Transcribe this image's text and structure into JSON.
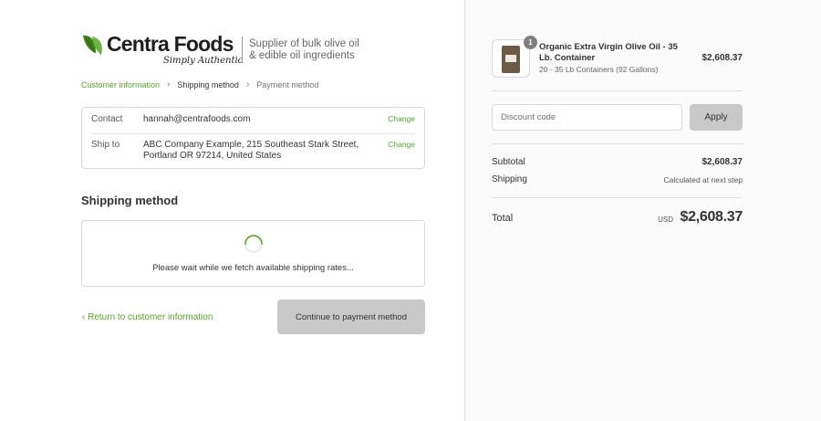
{
  "brand": {
    "name": "Centra Foods",
    "tagline": "Simply Authentic",
    "supplier_text": "Supplier of bulk olive oil & edible oil ingredients",
    "leaf_color": "#5aa02c"
  },
  "breadcrumb": {
    "items": [
      "Customer information",
      "Shipping method",
      "Payment method"
    ]
  },
  "review": {
    "contact_label": "Contact",
    "contact_value": "hannah@centrafoods.com",
    "ship_label": "Ship to",
    "ship_value": "ABC Company Example, 215 Southeast Stark Street, Portland OR 97214, United States",
    "change_label": "Change"
  },
  "shipping": {
    "title": "Shipping method",
    "loading_text": "Please wait while we fetch available shipping rates..."
  },
  "actions": {
    "return_label": "Return to customer information",
    "continue_label": "Continue to payment method"
  },
  "order": {
    "product_name": "Organic Extra Virgin Olive Oil - 35 Lb. Container",
    "product_variant": "20 - 35 Lb Containers (92 Gallons)",
    "product_price": "$2,608.37",
    "quantity": "1",
    "discount_placeholder": "Discount code",
    "apply_label": "Apply",
    "subtotal_label": "Subtotal",
    "subtotal_value": "$2,608.37",
    "shipping_label": "Shipping",
    "shipping_value": "Calculated at next step",
    "total_label": "Total",
    "currency": "USD",
    "total_value": "$2,608.37"
  },
  "colors": {
    "accent": "#5aa02c",
    "button_gray": "#c9c9c9",
    "sidebar_bg": "#fafafa"
  }
}
